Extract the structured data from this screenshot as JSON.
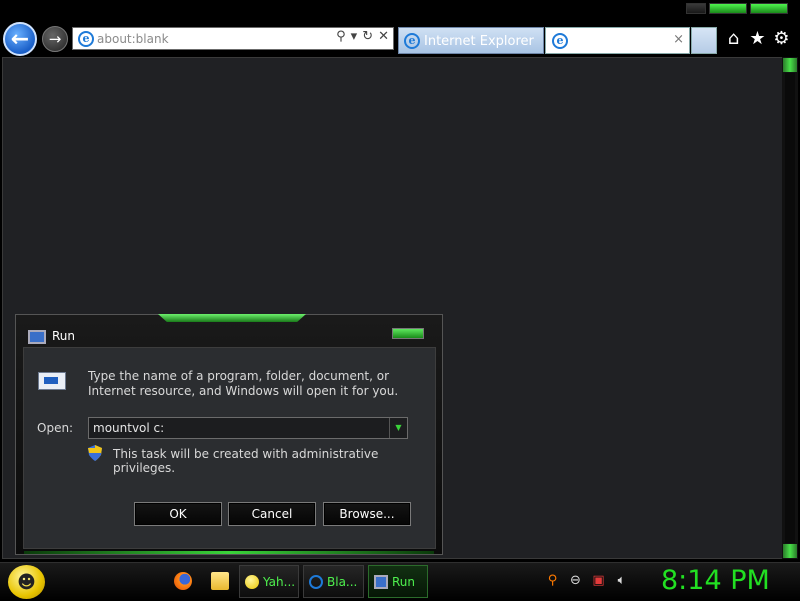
{
  "browser": {
    "address": {
      "value": "about:blank",
      "search_icon": "search-icon",
      "refresh_icon": "refresh-icon",
      "stop_icon": "close-icon"
    },
    "tabs": [
      {
        "label": "Internet Explorer",
        "active": false
      },
      {
        "label": "",
        "active": true,
        "close": "×"
      }
    ],
    "command_icons": [
      "home-icon",
      "star-icon",
      "gear-icon"
    ],
    "glyphs": {
      "back": "←",
      "forward": "→",
      "home": "⌂",
      "favorites": "★",
      "tools": "⚙",
      "search": "⚲",
      "dropdown": "▾",
      "refresh": "↻",
      "stop": "✕"
    }
  },
  "run_dialog": {
    "title": "Run",
    "description": "Type the name of a program, folder, document, or Internet resource, and Windows will open it for you.",
    "open_label": "Open:",
    "open_value": "mountvol c:",
    "admin_note": "This task will be created with administrative privileges.",
    "buttons": {
      "ok": "OK",
      "cancel": "Cancel",
      "browse": "Browse..."
    }
  },
  "taskbar": {
    "tasks": [
      {
        "label": "Yah...",
        "icon": "yahoo-messenger-icon"
      },
      {
        "label": "Bla...",
        "icon": "internet-explorer-icon"
      },
      {
        "label": "Run",
        "icon": "run-icon",
        "active": true
      }
    ],
    "tray_icons": [
      "search-icon",
      "minus-icon",
      "network-icon",
      "volume-icon"
    ],
    "clock": "8:14 PM"
  },
  "colors": {
    "accent": "#22e022",
    "background": "#202124"
  }
}
